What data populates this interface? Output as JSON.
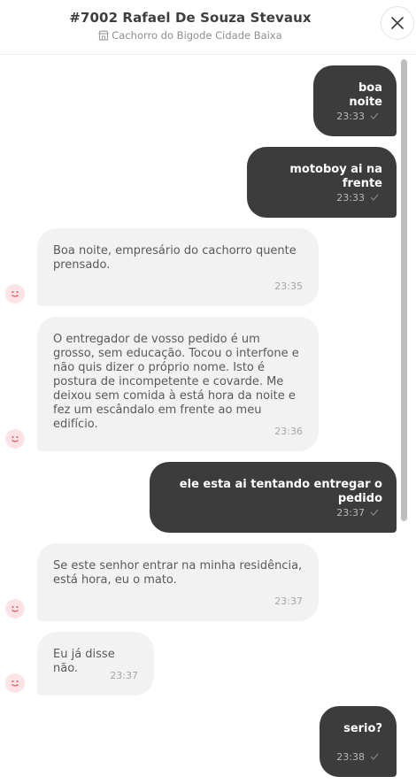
{
  "header": {
    "title": "#7002 Rafael De Souza Stevaux",
    "store": "Cachorro do Bigode Cidade Baixa",
    "store_icon": "store-icon",
    "close_icon": "close-icon"
  },
  "messages": [
    {
      "direction": "out",
      "text": "boa noite",
      "time": "23:33"
    },
    {
      "direction": "out",
      "text": "motoboy ai na frente",
      "time": "23:33"
    },
    {
      "direction": "in",
      "text": "Boa noite, empresário do cachorro quente prensado.",
      "time": "23:35"
    },
    {
      "direction": "in",
      "text": "O entregador de vosso pedido é um grosso, sem educação. Tocou o interfone e não quis dizer o próprio nome. Isto é postura de incompetente e covarde. Me deixou sem comida à está hora da noite e fez um escândalo em frente ao meu edifício.",
      "time": "23:36"
    },
    {
      "direction": "out",
      "text": "ele esta ai tentando entregar o pedido",
      "time": "23:37"
    },
    {
      "direction": "in",
      "text": "Se este senhor entrar na minha residência, está hora, eu o mato.",
      "time": "23:37"
    },
    {
      "direction": "in",
      "text": "Eu já disse não.",
      "time": "23:37"
    },
    {
      "direction": "out",
      "text": "serio?",
      "time": "23:38"
    }
  ],
  "colors": {
    "outgoing_bubble": "#3c3c3c",
    "incoming_bubble": "#f2f2f2",
    "avatar_bg": "#fde3e5",
    "avatar_fg": "#e0505c"
  }
}
